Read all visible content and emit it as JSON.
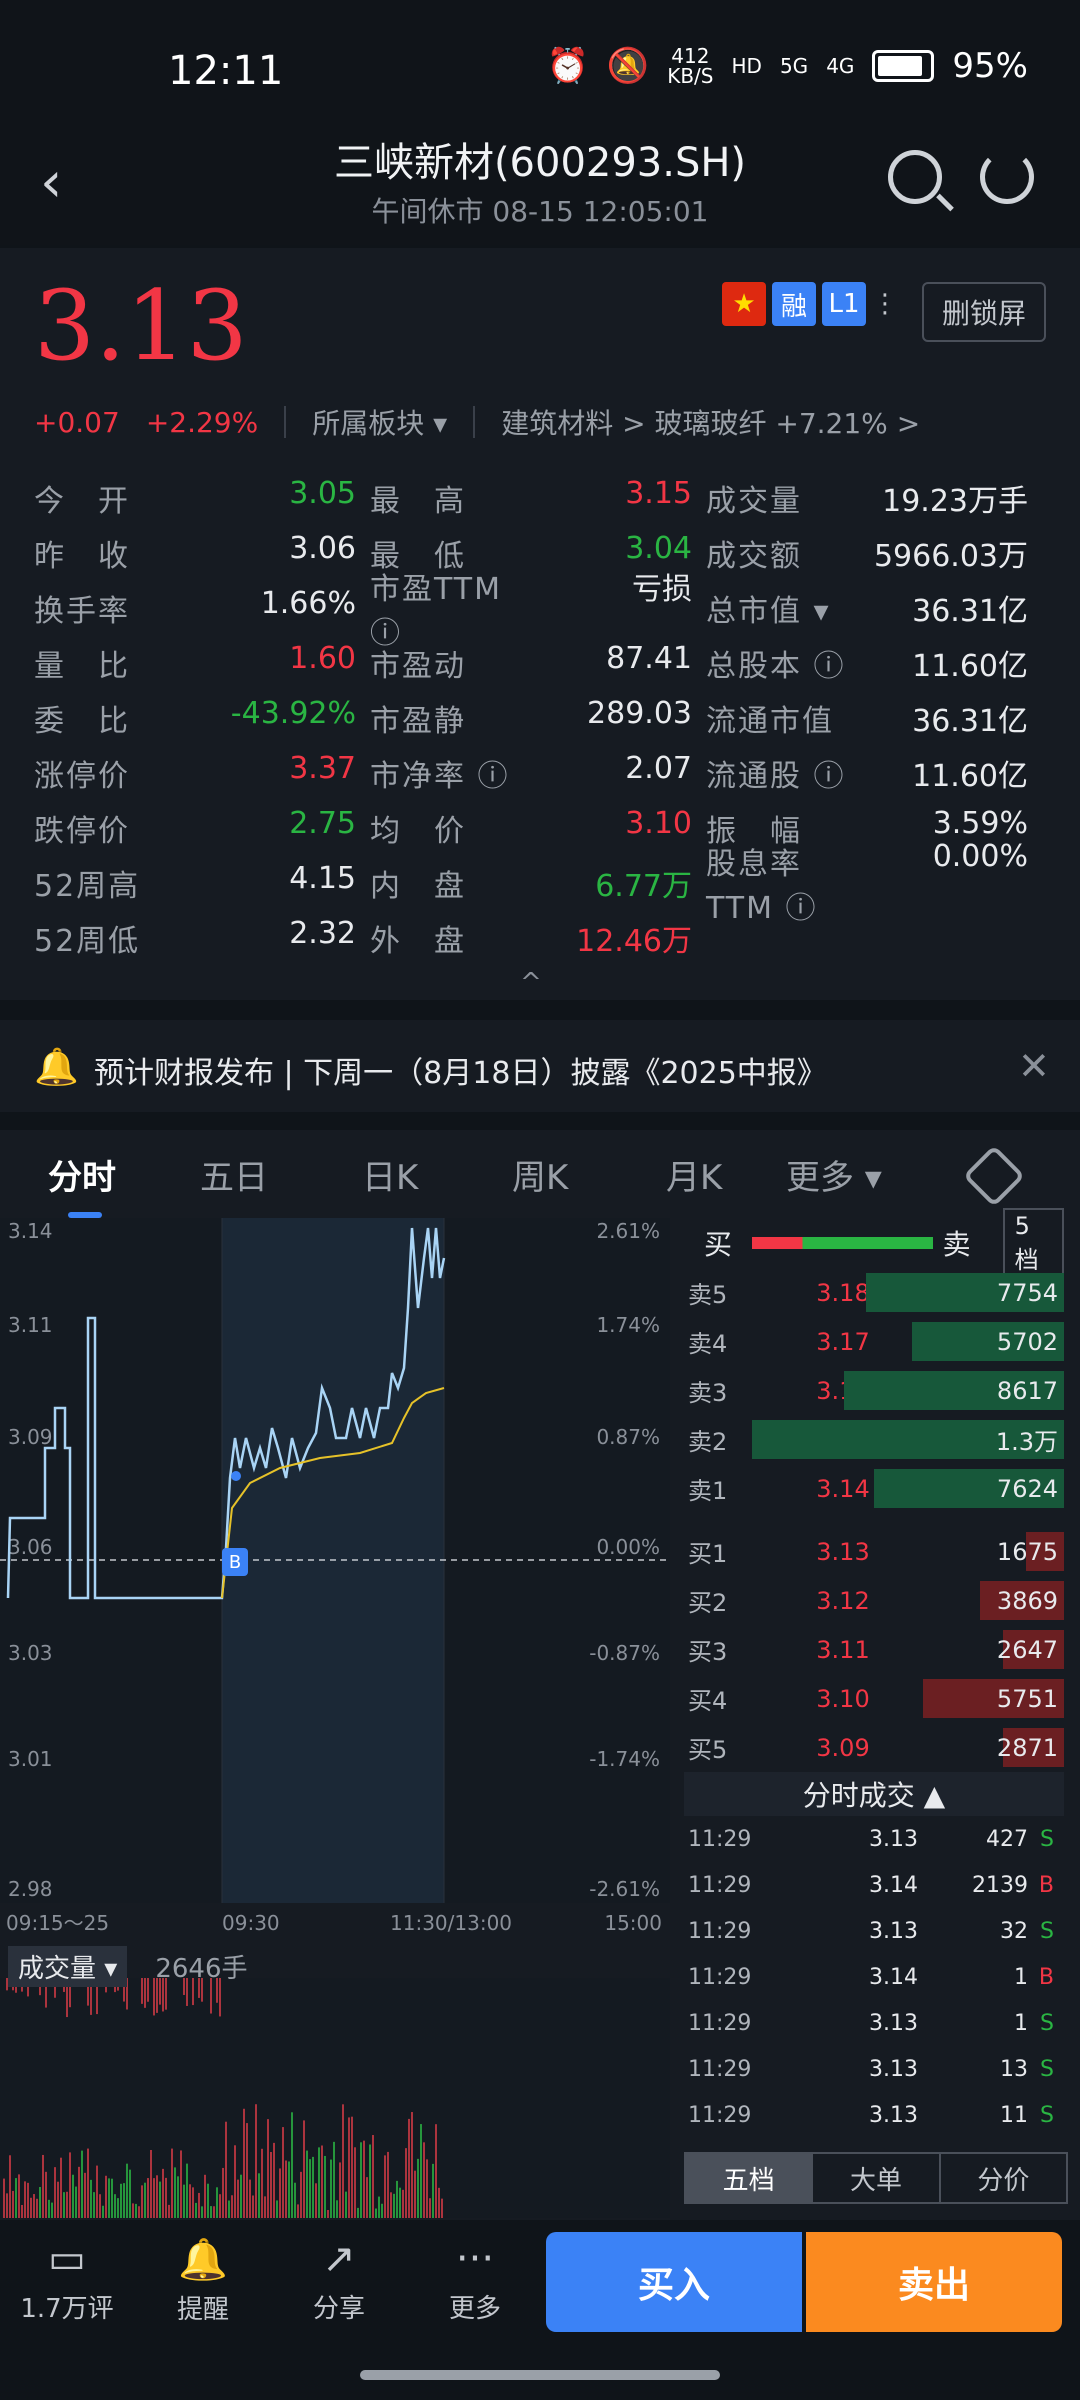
{
  "status": {
    "time": "12:11",
    "net_speed_top": "412",
    "net_speed_bottom": "KB/S",
    "hd": "HD",
    "sig1": "5G",
    "sig2": "4G",
    "battery": "95%"
  },
  "header": {
    "title": "三峡新材(600293.SH)",
    "subtitle": "午间休市 08-15 12:05:01"
  },
  "quote": {
    "price": "3.13",
    "badge_rong": "融",
    "badge_l1": "L1",
    "unlock_label": "删锁屏",
    "change": "+0.07",
    "change_pct": "+2.29%",
    "sector_label": "所属板块",
    "sector_path": "建筑材料 > 玻璃玻纤 +7.21% >",
    "collapse": "^"
  },
  "stats": [
    [
      {
        "label": "今　开",
        "value": "3.05",
        "color": "green"
      },
      {
        "label": "最　高",
        "value": "3.15",
        "color": "red"
      },
      {
        "label": "成交量",
        "value": "19.23万手",
        "color": "white"
      }
    ],
    [
      {
        "label": "昨　收",
        "value": "3.06",
        "color": "white"
      },
      {
        "label": "最　低",
        "value": "3.04",
        "color": "green"
      },
      {
        "label": "成交额",
        "value": "5966.03万",
        "color": "white"
      }
    ],
    [
      {
        "label": "换手率",
        "value": "1.66%",
        "color": "white"
      },
      {
        "label": "市盈TTM ⓘ",
        "value": "亏损",
        "color": "white"
      },
      {
        "label": "总市值 ▾",
        "value": "36.31亿",
        "color": "white"
      }
    ],
    [
      {
        "label": "量　比",
        "value": "1.60",
        "color": "red"
      },
      {
        "label": "市盈动",
        "value": "87.41",
        "color": "white"
      },
      {
        "label": "总股本 ⓘ",
        "value": "11.60亿",
        "color": "white"
      }
    ],
    [
      {
        "label": "委　比",
        "value": "-43.92%",
        "color": "green"
      },
      {
        "label": "市盈静",
        "value": "289.03",
        "color": "white"
      },
      {
        "label": "流通市值",
        "value": "36.31亿",
        "color": "white"
      }
    ],
    [
      {
        "label": "涨停价",
        "value": "3.37",
        "color": "red"
      },
      {
        "label": "市净率 ⓘ",
        "value": "2.07",
        "color": "white"
      },
      {
        "label": "流通股 ⓘ",
        "value": "11.60亿",
        "color": "white"
      }
    ],
    [
      {
        "label": "跌停价",
        "value": "2.75",
        "color": "green"
      },
      {
        "label": "均　价",
        "value": "3.10",
        "color": "red"
      },
      {
        "label": "振　幅",
        "value": "3.59%",
        "color": "white"
      }
    ],
    [
      {
        "label": "52周高",
        "value": "4.15",
        "color": "white"
      },
      {
        "label": "内　盘",
        "value": "6.77万",
        "color": "green"
      },
      {
        "label": "股息率TTM ⓘ",
        "value": "0.00%",
        "color": "white"
      }
    ],
    [
      {
        "label": "52周低",
        "value": "2.32",
        "color": "white"
      },
      {
        "label": "外　盘",
        "value": "12.46万",
        "color": "red"
      },
      {
        "label": "",
        "value": "",
        "color": "white"
      }
    ]
  ],
  "notice": {
    "text": "预计财报发布 | 下周一（8月18日）披露《2025中报》"
  },
  "tabs": [
    "分时",
    "五日",
    "日K",
    "周K",
    "月K",
    "更多 ▾"
  ],
  "chart": {
    "price_labels": [
      "3.14",
      "3.11",
      "3.09",
      "3.06",
      "3.03",
      "3.01",
      "2.98"
    ],
    "pct_labels": [
      "2.61%",
      "1.74%",
      "0.87%",
      "0.00%",
      "-0.87%",
      "-1.74%",
      "-2.61%"
    ],
    "time_labels": [
      "09:15～25",
      "09:30",
      "11:30/13:00",
      "15:00"
    ],
    "marker": "B",
    "volume_label": "成交量 ▾",
    "volume_value": "2646手"
  },
  "orderbook": {
    "buy_label": "买",
    "sell_label": "卖",
    "level_btn": "5档",
    "asks": [
      {
        "label": "卖5",
        "price": "3.18",
        "vol": "7754",
        "bar": 0.52
      },
      {
        "label": "卖4",
        "price": "3.17",
        "vol": "5702",
        "bar": 0.4
      },
      {
        "label": "卖3",
        "price": "3.16",
        "vol": "8617",
        "bar": 0.58
      },
      {
        "label": "卖2",
        "price": "3.15",
        "vol": "1.3万",
        "bar": 0.82
      },
      {
        "label": "卖1",
        "price": "3.14",
        "vol": "7624",
        "bar": 0.5
      }
    ],
    "bids": [
      {
        "label": "买1",
        "price": "3.13",
        "vol": "1675",
        "bar": 0.1
      },
      {
        "label": "买2",
        "price": "3.12",
        "vol": "3869",
        "bar": 0.22
      },
      {
        "label": "买3",
        "price": "3.11",
        "vol": "2647",
        "bar": 0.16
      },
      {
        "label": "买4",
        "price": "3.10",
        "vol": "5751",
        "bar": 0.37
      },
      {
        "label": "买5",
        "price": "3.09",
        "vol": "2871",
        "bar": 0.16
      }
    ],
    "ticks_title": "分时成交 ▲",
    "ticks": [
      {
        "time": "11:29",
        "price": "3.13",
        "vol": "427",
        "side": "S"
      },
      {
        "time": "11:29",
        "price": "3.14",
        "vol": "2139",
        "side": "B"
      },
      {
        "time": "11:29",
        "price": "3.13",
        "vol": "32",
        "side": "S"
      },
      {
        "time": "11:29",
        "price": "3.14",
        "vol": "1",
        "side": "B"
      },
      {
        "time": "11:29",
        "price": "3.13",
        "vol": "1",
        "side": "S"
      },
      {
        "time": "11:29",
        "price": "3.13",
        "vol": "13",
        "side": "S"
      },
      {
        "time": "11:29",
        "price": "3.13",
        "vol": "11",
        "side": "S"
      }
    ],
    "bottom_tabs": [
      "五档",
      "大单",
      "分价"
    ]
  },
  "nav": {
    "comments": "1.7万评",
    "remind": "提醒",
    "share": "分享",
    "more": "更多",
    "buy": "买入",
    "sell": "卖出"
  },
  "colors": {
    "up": "#f23645",
    "down": "#2ab543",
    "accent": "#3b82f6",
    "sell_btn": "#fb8a1f"
  }
}
